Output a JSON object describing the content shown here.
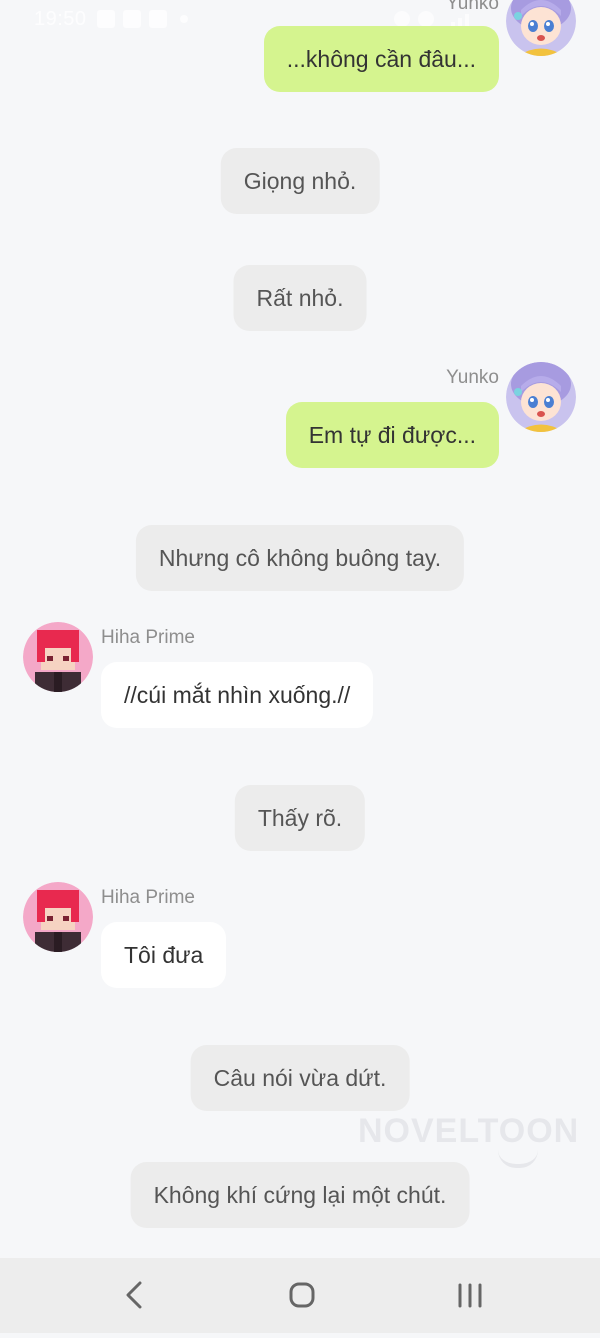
{
  "status_bar": {
    "time": "19:50"
  },
  "messages": [
    {
      "kind": "mine",
      "sender": "Yunko",
      "text": "...không cần đâu..."
    },
    {
      "kind": "narration",
      "text": "Giọng nhỏ."
    },
    {
      "kind": "narration",
      "text": "Rất nhỏ."
    },
    {
      "kind": "mine",
      "sender": "Yunko",
      "text": "Em tự đi được..."
    },
    {
      "kind": "narration",
      "text": "Nhưng cô không buông tay."
    },
    {
      "kind": "theirs",
      "sender": "Hiha Prime",
      "text": "//cúi mắt nhìn xuống.//"
    },
    {
      "kind": "narration",
      "text": "Thấy rõ."
    },
    {
      "kind": "theirs",
      "sender": "Hiha Prime",
      "text": "Tôi đưa"
    },
    {
      "kind": "narration",
      "text": "Câu nói vừa dứt."
    },
    {
      "kind": "narration",
      "text": "Không khí cứng lại một chút."
    }
  ],
  "watermark": {
    "text": "NOVELTOON"
  },
  "colors": {
    "mine_bubble": "#d5f48f",
    "theirs_bubble": "#ffffff",
    "narration_bubble": "#ececec",
    "background": "#f6f7f9",
    "nav_bar": "#ededed"
  },
  "icons": {
    "yunko_avatar": "anime-girl-avatar",
    "hiha_avatar": "pixel-character-avatar",
    "nav_back": "chevron-left-icon",
    "nav_home": "home-circle-icon",
    "nav_recent": "recent-apps-icon"
  }
}
